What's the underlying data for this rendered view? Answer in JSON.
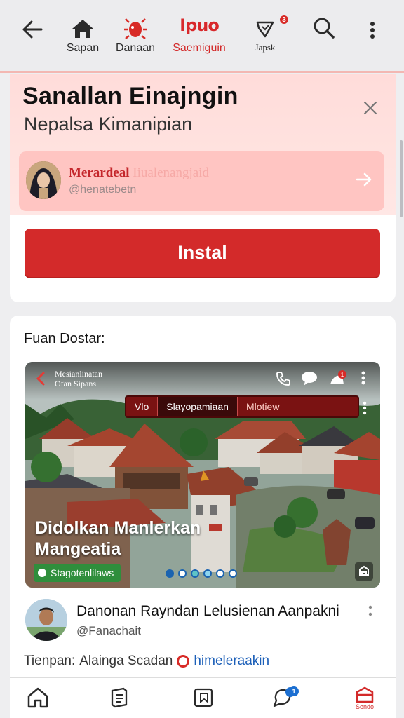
{
  "topnav": {
    "items": [
      {
        "label": "Sapan",
        "icon": "home-icon"
      },
      {
        "label": "Danaan",
        "icon": "bug-icon"
      },
      {
        "label": "Saemiguin",
        "icon": "logo-icon",
        "logo_text": "Ipuo"
      },
      {
        "label": "Japsk",
        "icon": "heart-tag-icon",
        "badge": "3"
      },
      {
        "label": "",
        "icon": "search-icon"
      },
      {
        "label": "",
        "icon": "more-vertical-icon"
      }
    ]
  },
  "install": {
    "title": "Sanallan Einajngin",
    "subtitle": "Nepalsa Kimanipian",
    "promo": {
      "name": "Merardeal",
      "name_faded": "Iiualenangjaid",
      "handle": "@henatebetn"
    },
    "button_label": "Instal"
  },
  "feed": {
    "label": "Fuan Dostar:",
    "media": {
      "channel": "Mesianlinatan\nOfan Sipans",
      "tabs": [
        "Vlo",
        "Slayopamiaan",
        "Mlotiew"
      ],
      "headline": "Didolkan Manlerkan\nMangeatia",
      "tag": "Stagotenlilaws",
      "notif_badge": "1",
      "pages": 6,
      "active_page": 1
    },
    "post": {
      "title": "Danonan Rayndan Lelusienan Aanpakni",
      "handle": "@Fanachait",
      "meta_prefix": "Tienpan:",
      "meta_place": "Alainga Scadan",
      "meta_link": "himeleraakin"
    }
  },
  "bottomnav": {
    "items": [
      {
        "icon": "home-icon",
        "label": ""
      },
      {
        "icon": "stack-icon",
        "label": ""
      },
      {
        "icon": "bookmark-icon",
        "label": ""
      },
      {
        "icon": "chat-icon",
        "label": "",
        "badge": "1"
      },
      {
        "icon": "store-icon",
        "label": "Sendo"
      }
    ]
  },
  "colors": {
    "accent": "#d32a2a",
    "promo_bg": "#ffc5c2",
    "link": "#1c5fb8"
  }
}
